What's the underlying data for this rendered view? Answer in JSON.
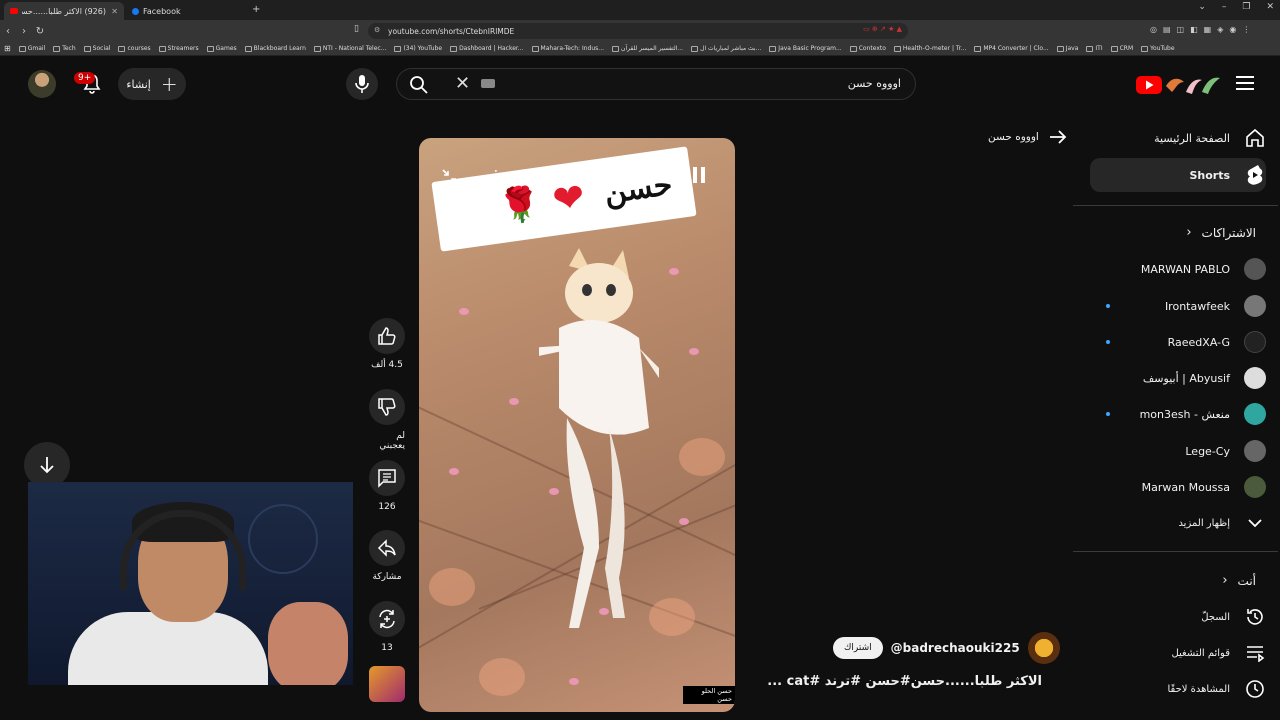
{
  "browser": {
    "tabs": [
      {
        "label": "(926) الاكثر طلبا......حسن#حسن",
        "active": true
      },
      {
        "label": "Facebook",
        "active": false
      }
    ],
    "new_tab": "+",
    "url": "youtube.com/shorts/CtebnIRlMDE",
    "bookmarks": [
      "Gmail",
      "Tech",
      "Social",
      "courses",
      "Streamers",
      "Games",
      "Blackboard Learn",
      "NTI - National Telec...",
      "(34) YouTube",
      "Dashboard | Hacker...",
      "Mahara-Tech: Indus...",
      "التفسير الميسر للقرآن...",
      "بث مباشر لمباريات ال...",
      "Java Basic Program...",
      "Contexto",
      "Health-O-meter | Tr...",
      "MP4 Converter | Clo...",
      "Java",
      "ITI",
      "CRM",
      "YouTube"
    ]
  },
  "header": {
    "notification_count": "9+",
    "create_label": "إنشاء",
    "search_query": "اوووه حسن"
  },
  "short": {
    "back_label": "اوووه حسن",
    "caption_word": "حسن",
    "watermark": "حسن الحلو حسن",
    "likes": "4.5 ألف",
    "dislike_label": "لم يعجبني",
    "comments": "126",
    "share_label": "مشاركة",
    "remix_count": "13",
    "channel_handle": "@badrechaouki225",
    "subscribe_label": "اشتراك",
    "title": "الاكثر طلبا......حسن#حسن #ترند #cat ..."
  },
  "sidebar": {
    "home_label": "الصفحة الرئيسية",
    "shorts_label": "Shorts",
    "subscriptions_title": "الاشتراكات",
    "subscriptions": [
      {
        "name": "MARWAN PABLO",
        "live": false,
        "color": "#555555"
      },
      {
        "name": "Irontawfeek",
        "live": true,
        "color": "#777777"
      },
      {
        "name": "RaeedXA-G",
        "live": true,
        "color": "#222222"
      },
      {
        "name": "أبيوسف | Abyusif",
        "live": false,
        "color": "#dddddd"
      },
      {
        "name": "mon3esh - منعش",
        "live": true,
        "color": "#2fa7a0"
      },
      {
        "name": "Lege-Cy",
        "live": false,
        "color": "#666666"
      },
      {
        "name": "Marwan Moussa",
        "live": false,
        "color": "#4a5a3a"
      }
    ],
    "show_more_label": "إظهار المزيد",
    "you_title": "أنت",
    "history_label": "السجلّ",
    "playlists_label": "قوائم التشغيل",
    "watch_later_label": "المشاهدة لاحقًا"
  }
}
